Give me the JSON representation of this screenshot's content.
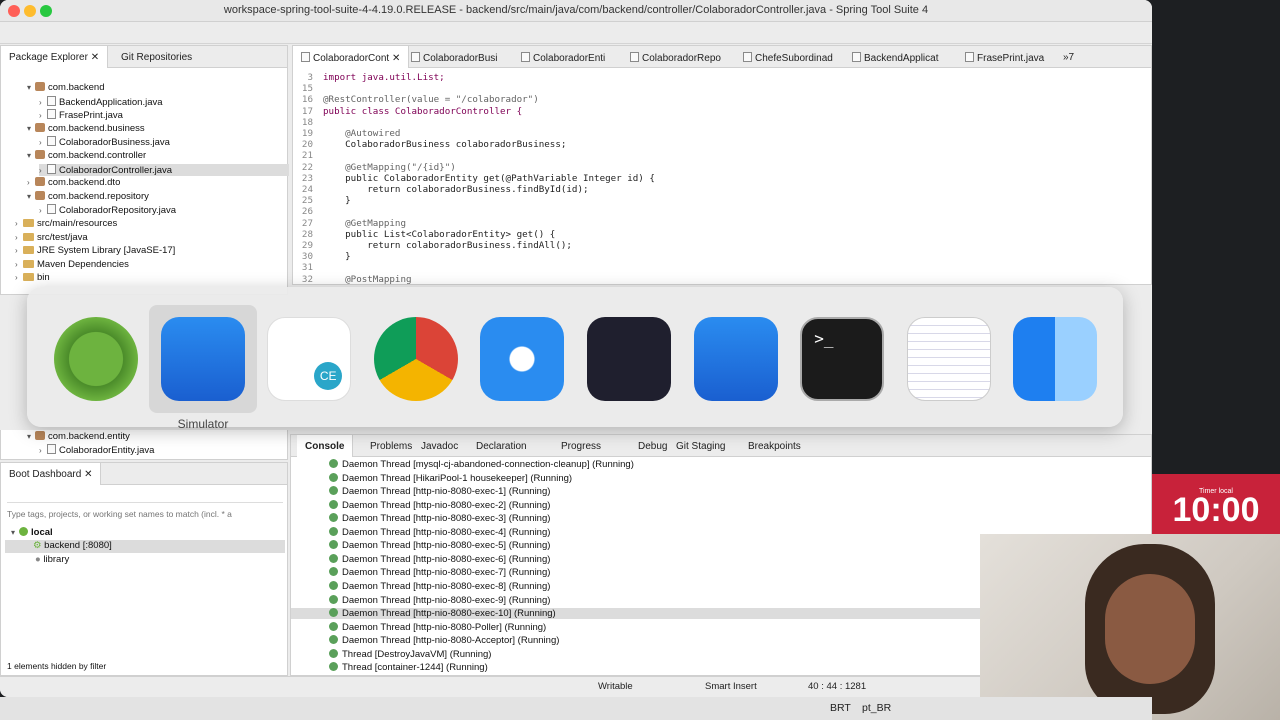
{
  "window_title": "workspace-spring-tool-suite-4-4.19.0.RELEASE - backend/src/main/java/com/backend/controller/ColaboradorController.java - Spring Tool Suite 4",
  "left_panel": {
    "tabs": [
      "Package Explorer",
      "Git Repositories"
    ],
    "tree": [
      {
        "label": "com.backend",
        "type": "pkg",
        "indent": 1,
        "expanded": true
      },
      {
        "label": "BackendApplication.java",
        "type": "java",
        "indent": 2
      },
      {
        "label": "FrasePrint.java",
        "type": "java",
        "indent": 2
      },
      {
        "label": "com.backend.business",
        "type": "pkg",
        "indent": 1,
        "expanded": true
      },
      {
        "label": "ColaboradorBusiness.java",
        "type": "java",
        "indent": 2
      },
      {
        "label": "com.backend.controller",
        "type": "pkg",
        "indent": 1,
        "expanded": true
      },
      {
        "label": "ColaboradorController.java",
        "type": "java",
        "indent": 2,
        "selected": true
      },
      {
        "label": "com.backend.dto",
        "type": "pkg",
        "indent": 1
      },
      {
        "label": "com.backend.repository",
        "type": "pkg",
        "indent": 1,
        "expanded": true
      },
      {
        "label": "ColaboradorRepository.java",
        "type": "java",
        "indent": 2
      },
      {
        "label": "src/main/resources",
        "type": "folder",
        "indent": 0
      },
      {
        "label": "src/test/java",
        "type": "folder",
        "indent": 0
      },
      {
        "label": "JRE System Library [JavaSE-17]",
        "type": "lib",
        "indent": 0
      },
      {
        "label": "Maven Dependencies",
        "type": "lib",
        "indent": 0
      },
      {
        "label": "bin",
        "type": "folder",
        "indent": 0
      }
    ],
    "lower_tree": [
      {
        "label": "com.backend.entity",
        "type": "pkg",
        "indent": 1,
        "expanded": true
      },
      {
        "label": "ColaboradorEntity.java",
        "type": "java",
        "indent": 2
      }
    ]
  },
  "editor": {
    "tabs": [
      "ColaboradorCont",
      "ColaboradorBusi",
      "ColaboradorEnti",
      "ColaboradorRepo",
      "ChefeSubordinad",
      "BackendApplicat",
      "FrasePrint.java"
    ],
    "more_tabs": "»7",
    "lines": [
      {
        "n": "3",
        "kind": "import",
        "text": "import java.util.List;"
      },
      {
        "n": "15",
        "kind": "plain",
        "text": ""
      },
      {
        "n": "16",
        "kind": "ann",
        "text": "@RestController(value = \"/colaborador\")"
      },
      {
        "n": "17",
        "kind": "classdecl",
        "text": "public class ColaboradorController {"
      },
      {
        "n": "18",
        "kind": "plain",
        "text": ""
      },
      {
        "n": "19",
        "kind": "ann2",
        "text": "    @Autowired"
      },
      {
        "n": "20",
        "kind": "plain",
        "text": "    ColaboradorBusiness colaboradorBusiness;"
      },
      {
        "n": "21",
        "kind": "plain",
        "text": ""
      },
      {
        "n": "22",
        "kind": "ann2",
        "text": "    @GetMapping(\"/{id}\")"
      },
      {
        "n": "23",
        "kind": "plain",
        "text": "    public ColaboradorEntity get(@PathVariable Integer id) {"
      },
      {
        "n": "24",
        "kind": "plain",
        "text": "        return colaboradorBusiness.findById(id);"
      },
      {
        "n": "25",
        "kind": "plain",
        "text": "    }"
      },
      {
        "n": "26",
        "kind": "plain",
        "text": ""
      },
      {
        "n": "27",
        "kind": "ann2",
        "text": "    @GetMapping"
      },
      {
        "n": "28",
        "kind": "plain",
        "text": "    public List<ColaboradorEntity> get() {"
      },
      {
        "n": "29",
        "kind": "plain",
        "text": "        return colaboradorBusiness.findAll();"
      },
      {
        "n": "30",
        "kind": "plain",
        "text": "    }"
      },
      {
        "n": "31",
        "kind": "plain",
        "text": ""
      },
      {
        "n": "32",
        "kind": "ann2",
        "text": "    @PostMapping"
      }
    ]
  },
  "app_switcher": {
    "apps": [
      "Spring Tool Suite",
      "Simulator",
      "DBeaver CE",
      "Google Chrome",
      "Safari",
      "OBS",
      "Xcode",
      "Terminal",
      "TextEdit",
      "Finder"
    ],
    "selected_label": "Simulator"
  },
  "boot_dashboard": {
    "tab": "Boot Dashboard",
    "filter_placeholder": "Type tags, projects, or working set names to match (incl. * a",
    "local": "local",
    "backend": "backend [:8080]",
    "library": "library",
    "footer": "1 elements hidden by filter"
  },
  "console": {
    "tabs": [
      "Console",
      "Problems",
      "Javadoc",
      "Declaration",
      "Progress",
      "Debug",
      "Git Staging",
      "Breakpoints"
    ],
    "threads": [
      "Daemon Thread [mysql-cj-abandoned-connection-cleanup] (Running)",
      "Daemon Thread [HikariPool-1 housekeeper] (Running)",
      "Daemon Thread [http-nio-8080-exec-1] (Running)",
      "Daemon Thread [http-nio-8080-exec-2] (Running)",
      "Daemon Thread [http-nio-8080-exec-3] (Running)",
      "Daemon Thread [http-nio-8080-exec-4] (Running)",
      "Daemon Thread [http-nio-8080-exec-5] (Running)",
      "Daemon Thread [http-nio-8080-exec-6] (Running)",
      "Daemon Thread [http-nio-8080-exec-7] (Running)",
      "Daemon Thread [http-nio-8080-exec-8] (Running)",
      "Daemon Thread [http-nio-8080-exec-9] (Running)",
      "Daemon Thread [http-nio-8080-exec-10] (Running)",
      "Daemon Thread [http-nio-8080-Poller] (Running)",
      "Daemon Thread [http-nio-8080-Acceptor] (Running)",
      "Thread [DestroyJavaVM] (Running)",
      "Thread [container-1244] (Running)"
    ],
    "selected_index": 11
  },
  "status": {
    "writable": "Writable",
    "insert": "Smart Insert",
    "position": "40 : 44 : 1281"
  },
  "timer": {
    "label": "Timer local",
    "value": "10:00"
  },
  "menubar": {
    "lang1": "BRT",
    "lang2": "pt_BR"
  }
}
